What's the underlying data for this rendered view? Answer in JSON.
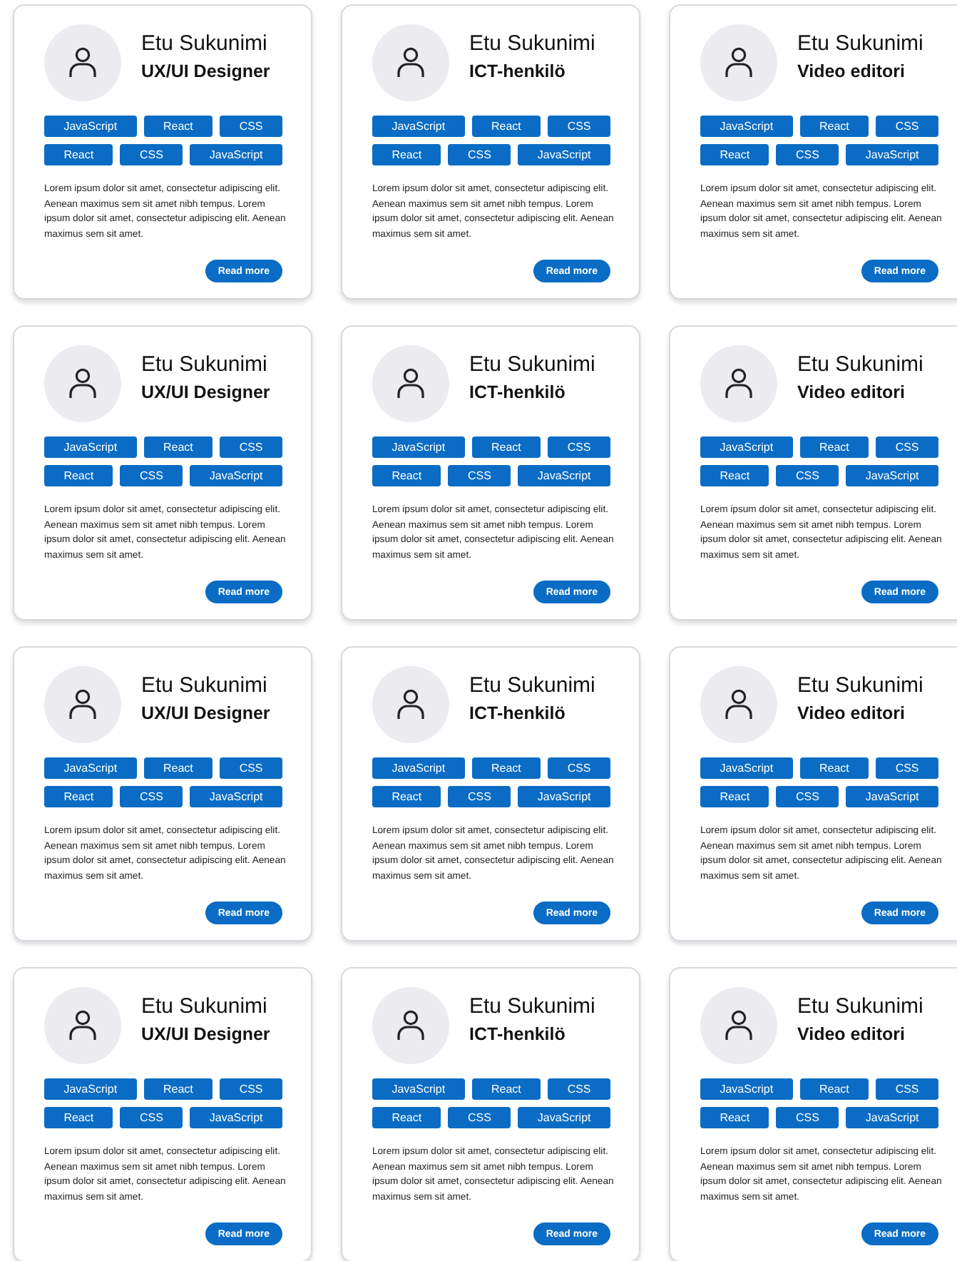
{
  "cards": [
    {
      "name": "Etu Sukunimi",
      "title": "UX/UI Designer",
      "tag_rows": [
        [
          "JavaScript",
          "React",
          "CSS"
        ],
        [
          "React",
          "CSS",
          "JavaScript"
        ]
      ],
      "description": "Lorem ipsum dolor sit amet, consectetur adipiscing elit. Aenean maximus sem sit amet nibh tempus. Lorem ipsum dolor sit amet, consectetur adipiscing elit. Aenean maximus sem sit amet.",
      "button": "Read more"
    },
    {
      "name": "Etu Sukunimi",
      "title": "ICT-henkilö",
      "tag_rows": [
        [
          "JavaScript",
          "React",
          "CSS"
        ],
        [
          "React",
          "CSS",
          "JavaScript"
        ]
      ],
      "description": "Lorem ipsum dolor sit amet, consectetur adipiscing elit. Aenean maximus sem sit amet nibh tempus. Lorem ipsum dolor sit amet, consectetur adipiscing elit. Aenean maximus sem sit amet.",
      "button": "Read more"
    },
    {
      "name": "Etu Sukunimi",
      "title": "Video editori",
      "tag_rows": [
        [
          "JavaScript",
          "React",
          "CSS"
        ],
        [
          "React",
          "CSS",
          "JavaScript"
        ]
      ],
      "description": "Lorem ipsum dolor sit amet, consectetur adipiscing elit. Aenean maximus sem sit amet nibh tempus. Lorem ipsum dolor sit amet, consectetur adipiscing elit. Aenean maximus sem sit amet.",
      "button": "Read more"
    },
    {
      "name": "Etu Sukunimi",
      "title": "UX/UI Designer",
      "tag_rows": [
        [
          "JavaScript",
          "React",
          "CSS"
        ],
        [
          "React",
          "CSS",
          "JavaScript"
        ]
      ],
      "description": "Lorem ipsum dolor sit amet, consectetur adipiscing elit. Aenean maximus sem sit amet nibh tempus. Lorem ipsum dolor sit amet, consectetur adipiscing elit. Aenean maximus sem sit amet.",
      "button": "Read more"
    },
    {
      "name": "Etu Sukunimi",
      "title": "ICT-henkilö",
      "tag_rows": [
        [
          "JavaScript",
          "React",
          "CSS"
        ],
        [
          "React",
          "CSS",
          "JavaScript"
        ]
      ],
      "description": "Lorem ipsum dolor sit amet, consectetur adipiscing elit. Aenean maximus sem sit amet nibh tempus. Lorem ipsum dolor sit amet, consectetur adipiscing elit. Aenean maximus sem sit amet.",
      "button": "Read more"
    },
    {
      "name": "Etu Sukunimi",
      "title": "Video editori",
      "tag_rows": [
        [
          "JavaScript",
          "React",
          "CSS"
        ],
        [
          "React",
          "CSS",
          "JavaScript"
        ]
      ],
      "description": "Lorem ipsum dolor sit amet, consectetur adipiscing elit. Aenean maximus sem sit amet nibh tempus. Lorem ipsum dolor sit amet, consectetur adipiscing elit. Aenean maximus sem sit amet.",
      "button": "Read more"
    },
    {
      "name": "Etu Sukunimi",
      "title": "UX/UI Designer",
      "tag_rows": [
        [
          "JavaScript",
          "React",
          "CSS"
        ],
        [
          "React",
          "CSS",
          "JavaScript"
        ]
      ],
      "description": "Lorem ipsum dolor sit amet, consectetur adipiscing elit. Aenean maximus sem sit amet nibh tempus. Lorem ipsum dolor sit amet, consectetur adipiscing elit. Aenean maximus sem sit amet.",
      "button": "Read more"
    },
    {
      "name": "Etu Sukunimi",
      "title": "ICT-henkilö",
      "tag_rows": [
        [
          "JavaScript",
          "React",
          "CSS"
        ],
        [
          "React",
          "CSS",
          "JavaScript"
        ]
      ],
      "description": "Lorem ipsum dolor sit amet, consectetur adipiscing elit. Aenean maximus sem sit amet nibh tempus. Lorem ipsum dolor sit amet, consectetur adipiscing elit. Aenean maximus sem sit amet.",
      "button": "Read more"
    },
    {
      "name": "Etu Sukunimi",
      "title": "Video editori",
      "tag_rows": [
        [
          "JavaScript",
          "React",
          "CSS"
        ],
        [
          "React",
          "CSS",
          "JavaScript"
        ]
      ],
      "description": "Lorem ipsum dolor sit amet, consectetur adipiscing elit. Aenean maximus sem sit amet nibh tempus. Lorem ipsum dolor sit amet, consectetur adipiscing elit. Aenean maximus sem sit amet.",
      "button": "Read more"
    },
    {
      "name": "Etu Sukunimi",
      "title": "UX/UI Designer",
      "tag_rows": [
        [
          "JavaScript",
          "React",
          "CSS"
        ],
        [
          "React",
          "CSS",
          "JavaScript"
        ]
      ],
      "description": "Lorem ipsum dolor sit amet, consectetur adipiscing elit. Aenean maximus sem sit amet nibh tempus. Lorem ipsum dolor sit amet, consectetur adipiscing elit. Aenean maximus sem sit amet.",
      "button": "Read more"
    },
    {
      "name": "Etu Sukunimi",
      "title": "ICT-henkilö",
      "tag_rows": [
        [
          "JavaScript",
          "React",
          "CSS"
        ],
        [
          "React",
          "CSS",
          "JavaScript"
        ]
      ],
      "description": "Lorem ipsum dolor sit amet, consectetur adipiscing elit. Aenean maximus sem sit amet nibh tempus. Lorem ipsum dolor sit amet, consectetur adipiscing elit. Aenean maximus sem sit amet.",
      "button": "Read more"
    },
    {
      "name": "Etu Sukunimi",
      "title": "Video editori",
      "tag_rows": [
        [
          "JavaScript",
          "React",
          "CSS"
        ],
        [
          "React",
          "CSS",
          "JavaScript"
        ]
      ],
      "description": "Lorem ipsum dolor sit amet, consectetur adipiscing elit. Aenean maximus sem sit amet nibh tempus. Lorem ipsum dolor sit amet, consectetur adipiscing elit. Aenean maximus sem sit amet.",
      "button": "Read more"
    }
  ]
}
